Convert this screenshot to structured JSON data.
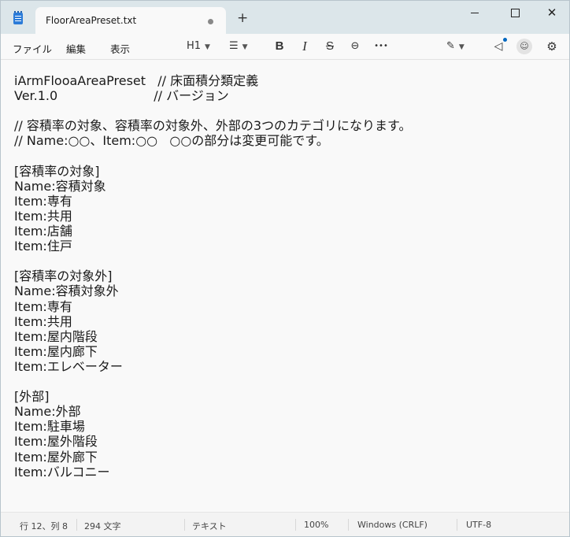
{
  "titlebar": {
    "tab_title": "FloorAreaPreset.txt",
    "new_tab_label": "+",
    "minimize_label": "",
    "maximize_label": "",
    "close_label": "✕"
  },
  "menu": {
    "file": "ファイル",
    "edit": "編集",
    "view": "表示"
  },
  "toolbar": {
    "heading": "H1",
    "list_icon": "☰",
    "bold": "B",
    "italic": "I",
    "strikethrough": "S",
    "link_icon": "⊖",
    "more": "•••",
    "copilot_icon": "✎",
    "announce_icon": "◁",
    "avatar_icon": "☺",
    "settings_icon": "⚙"
  },
  "document": {
    "lines": [
      "iArmFlooaAreaPreset   // 床面積分類定義",
      "Ver.1.0                        // バージョン",
      "",
      "// 容積率の対象、容積率の対象外、外部の3つのカテゴリになります。",
      "// Name:○○、Item:○○   ○○の部分は変更可能です。",
      "",
      "[容積率の対象]",
      "Name:容積対象",
      "Item:専有",
      "Item:共用",
      "Item:店舗",
      "Item:住戸",
      "",
      "[容積率の対象外]",
      "Name:容積対象外",
      "Item:専有",
      "Item:共用",
      "Item:屋内階段",
      "Item:屋内廊下",
      "Item:エレベーター",
      "",
      "[外部]",
      "Name:外部",
      "Item:駐車場",
      "Item:屋外階段",
      "Item:屋外廊下",
      "Item:バルコニー"
    ]
  },
  "status": {
    "position": "行 12、列 8",
    "chars": "294 文字",
    "format": "テキスト",
    "zoom": "100%",
    "line_ending": "Windows (CRLF)",
    "encoding": "UTF-8"
  },
  "colors": {
    "titlebar_bg": "#dce6ea",
    "editor_bg": "#f9f9f9",
    "accent": "#0067c0"
  }
}
